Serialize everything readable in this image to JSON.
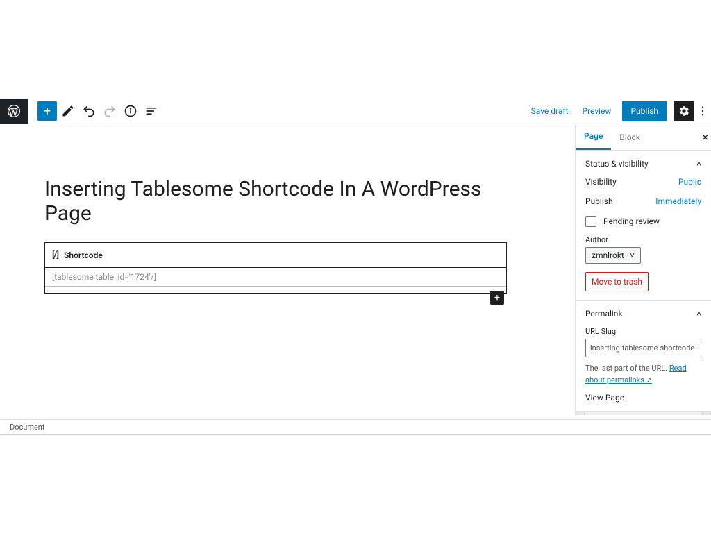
{
  "toolbar": {
    "save_draft": "Save draft",
    "preview": "Preview",
    "publish": "Publish"
  },
  "editor": {
    "page_title": "Inserting Tablesome Shortcode In A WordPress Page",
    "shortcode_label": "Shortcode",
    "shortcode_value": "[tablesome table_id='1724'/]"
  },
  "sidebar": {
    "tabs": {
      "page": "Page",
      "block": "Block"
    },
    "status_panel": {
      "title": "Status & visibility",
      "visibility_label": "Visibility",
      "visibility_value": "Public",
      "publish_label": "Publish",
      "publish_value": "Immediately",
      "pending_review": "Pending review",
      "author_label": "Author",
      "author_value": "zmnlrokt",
      "trash": "Move to trash"
    },
    "permalink_panel": {
      "title": "Permalink",
      "slug_label": "URL Slug",
      "slug_value": "inserting-tablesome-shortcode-in-a-wo",
      "help_prefix": "The last part of the URL. ",
      "help_link": "Read about permalinks",
      "view_page": "View Page"
    }
  },
  "breadcrumb": "Document"
}
